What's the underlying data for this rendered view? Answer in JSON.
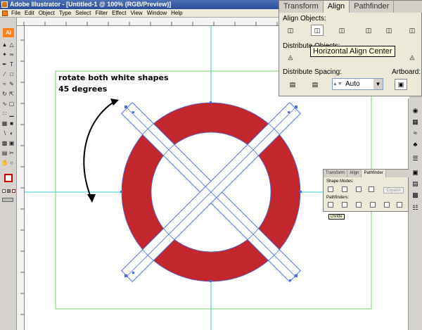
{
  "window": {
    "title": "Adobe Illustrator - [Untitled-1 @ 100% (RGB/Preview)]"
  },
  "menubar": {
    "items": [
      "File",
      "Edit",
      "Object",
      "Type",
      "Select",
      "Filter",
      "Effect",
      "View",
      "Window",
      "Help"
    ]
  },
  "toolbar": {
    "logo": "Ai"
  },
  "annotation": {
    "line1": "rotate both white shapes",
    "line2": "45 degrees"
  },
  "align_panel": {
    "tabs": [
      "Transform",
      "Align",
      "Pathfinder"
    ],
    "active_tab": "Align",
    "align_objects_label": "Align Objects:",
    "distribute_objects_label": "Distribute Objects:",
    "distribute_spacing_label": "Distribute Spacing:",
    "artboard_label": "Artboard:",
    "spacing_value": "Auto",
    "tooltip": "Horizontal Align Center"
  },
  "pathfinder_panel": {
    "tabs": [
      "Transform",
      "Align",
      "Pathfinder"
    ],
    "active_tab": "Pathfinder",
    "shape_modes_label": "Shape Modes:",
    "pathfinders_label": "Pathfinders:",
    "expand_label": "Expand",
    "tooltip": "Divide"
  },
  "colors": {
    "ring_red": "#c1272d",
    "guide_cyan": "#33cccc",
    "artboard_green": "#7ccf6e",
    "selection_blue": "#4a6fe0",
    "panel_bg": "#ece9d8"
  },
  "icons": [
    "selection-tool-icon",
    "direct-selection-icon",
    "pen-icon",
    "type-icon",
    "line-icon",
    "rectangle-icon",
    "brush-icon",
    "pencil-icon",
    "rotate-icon",
    "scale-icon",
    "warp-icon",
    "graph-icon",
    "mesh-icon",
    "gradient-icon",
    "eyedropper-icon",
    "blend-icon",
    "symbol-sprayer-icon",
    "slice-icon",
    "scissors-icon",
    "hand-icon",
    "zoom-icon",
    "fill-stroke-icon"
  ]
}
